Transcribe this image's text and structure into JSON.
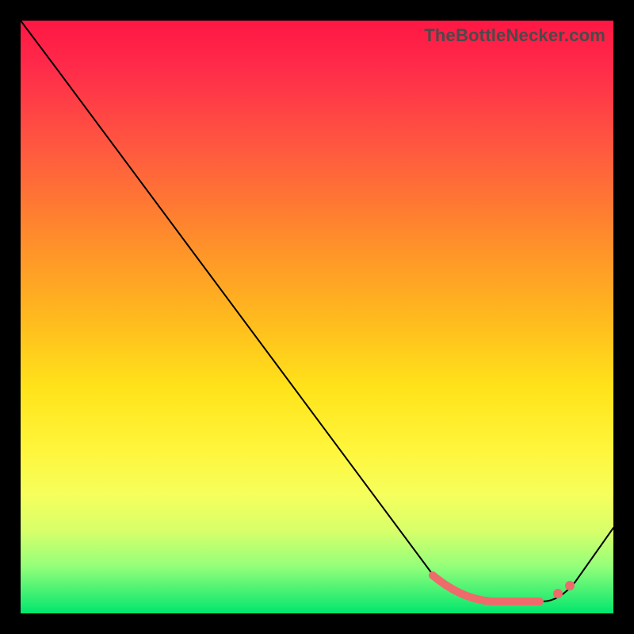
{
  "watermark": "TheBottleNecker.com",
  "colors": {
    "frame": "#000000",
    "watermark_text": "#4a4a4a",
    "curve": "#000000",
    "highlight": "#ee6b6b",
    "gradient_top": "#ff1744",
    "gradient_bottom": "#00e66e"
  },
  "chart_data": {
    "type": "line",
    "title": "",
    "xlabel": "",
    "ylabel": "",
    "xlim": [
      0,
      100
    ],
    "ylim": [
      0,
      100
    ],
    "x": [
      0,
      6,
      70,
      78,
      88,
      100
    ],
    "values": [
      100,
      92,
      6,
      2,
      2,
      18
    ],
    "optimal_range_x": [
      70,
      88
    ],
    "highlight_dots_x": [
      90,
      92
    ]
  }
}
